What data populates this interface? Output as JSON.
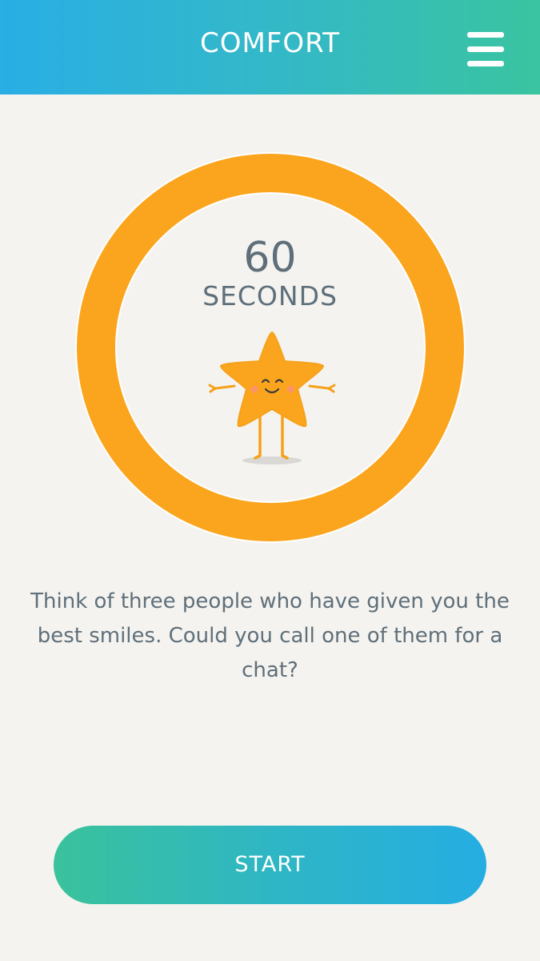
{
  "header": {
    "title": "COMFORT",
    "menu_icon": "hamburger-menu-icon"
  },
  "timer": {
    "value": "60",
    "unit": "SECONDS",
    "progress": 1.0,
    "ring_color": "#fba51e",
    "mascot_icon": "smiling-star-icon"
  },
  "prompt": {
    "text": "Think of three people who have given you the best smiles. Could you call one of them for a chat?"
  },
  "actions": {
    "start_label": "START"
  },
  "colors": {
    "header_gradient_start": "#29aee5",
    "header_gradient_end": "#3ac4a0",
    "background": "#f4f3ef",
    "text": "#5f6f7a",
    "accent": "#fba51e"
  }
}
